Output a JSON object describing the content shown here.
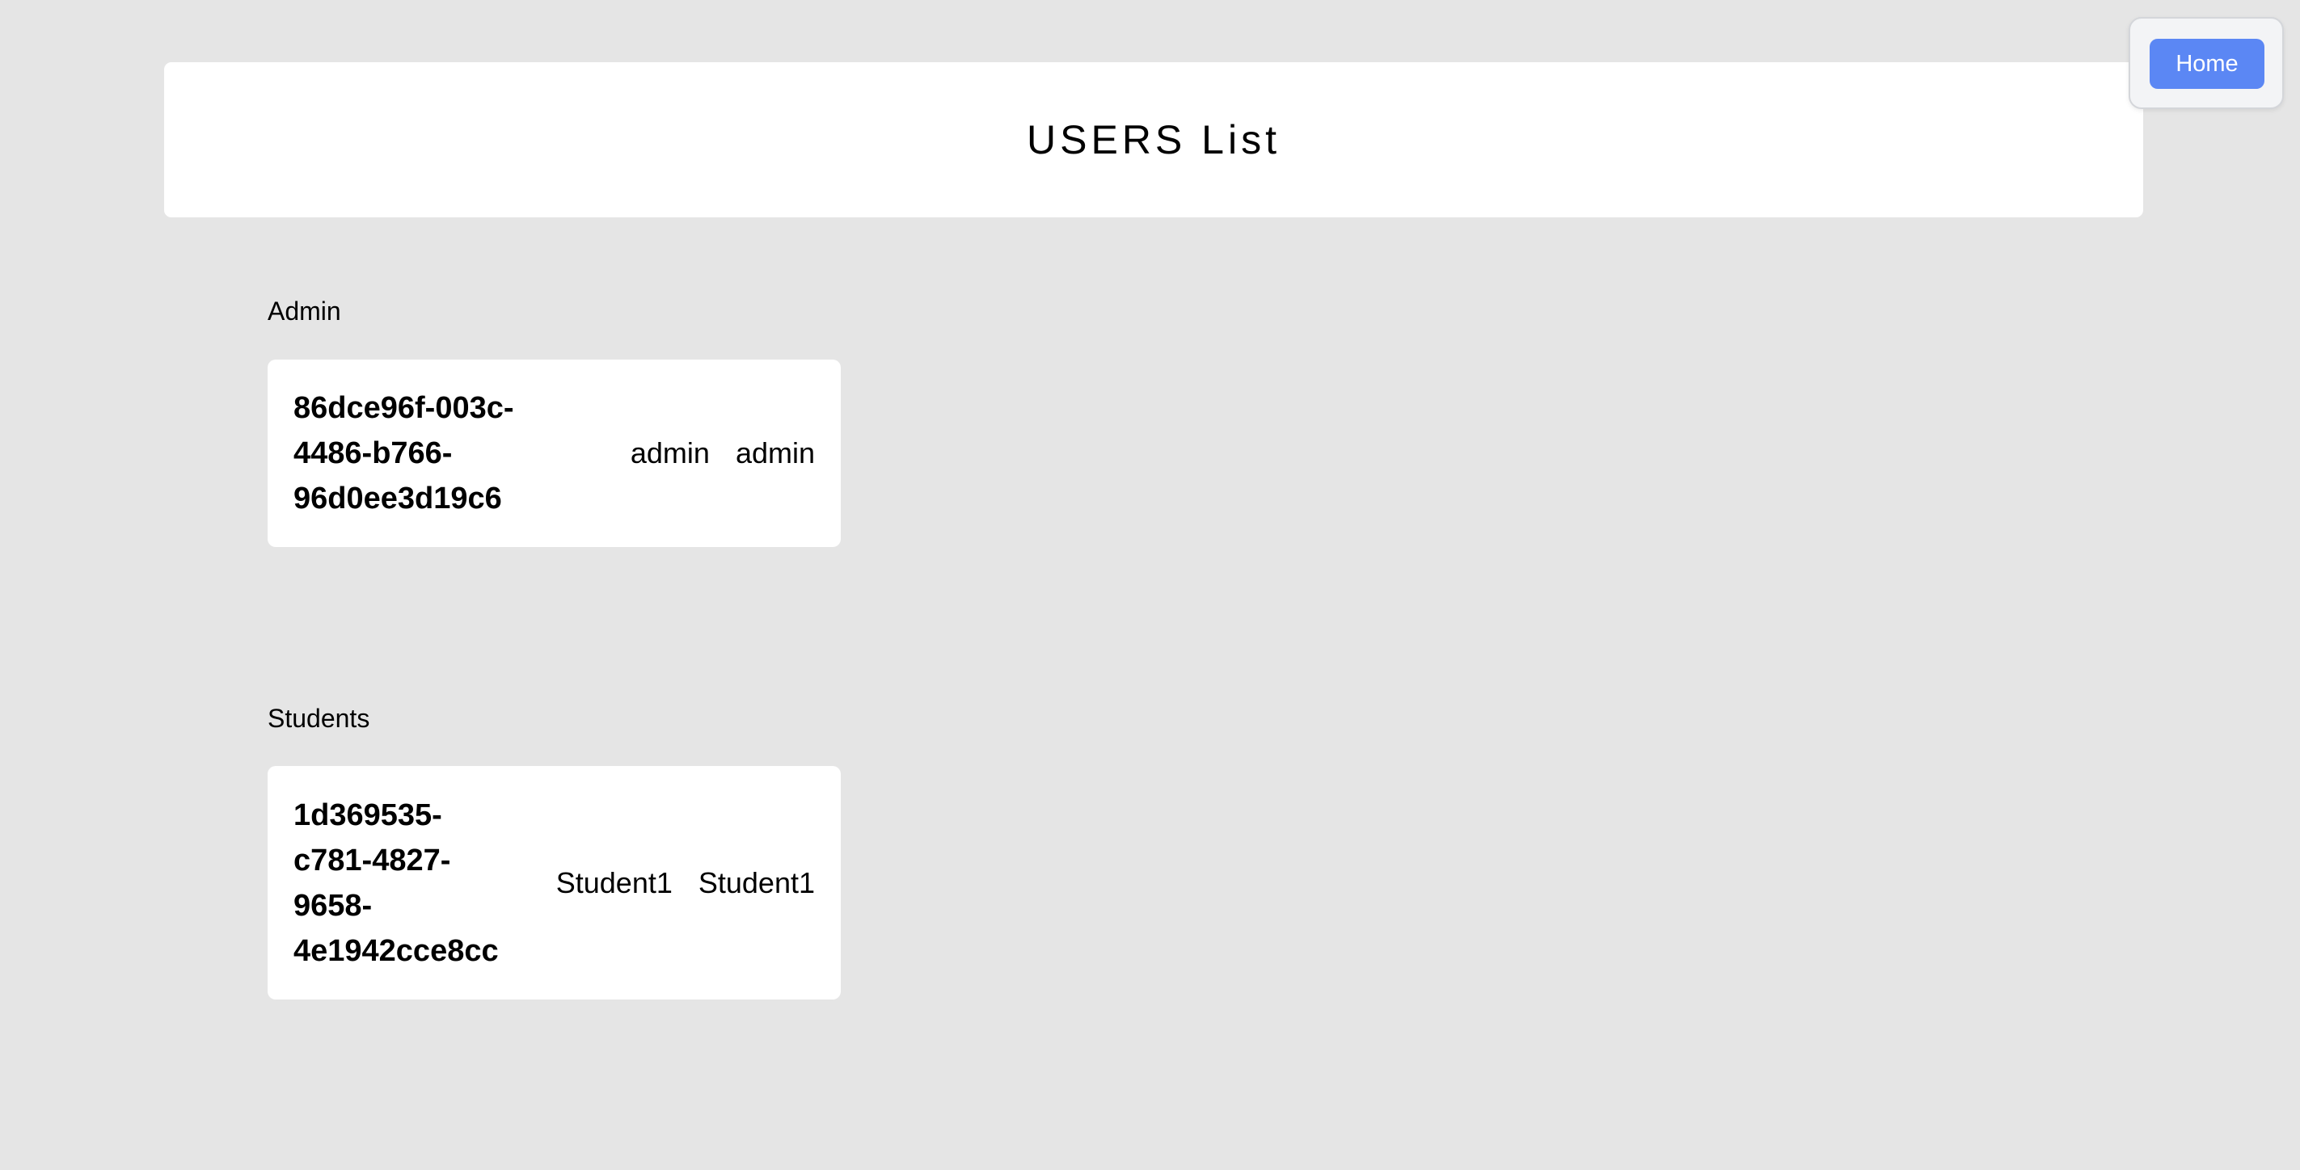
{
  "header": {
    "title": "USERS List"
  },
  "nav": {
    "home_label": "Home"
  },
  "sections": [
    {
      "label": "Admin",
      "users": [
        {
          "id_lines": [
            "86dce96f-003c-",
            "4486-b766-",
            "96d0ee3d19c6"
          ],
          "field1": "admin",
          "field2": "admin"
        }
      ]
    },
    {
      "label": "Students",
      "users": [
        {
          "id_lines": [
            "1d369535-",
            "c781-4827-",
            "9658-",
            "4e1942cce8cc"
          ],
          "field1": "Student1",
          "field2": "Student1"
        }
      ]
    }
  ],
  "colors": {
    "background": "#e5e5e5",
    "card": "#ffffff",
    "home_button": "#5b87f4"
  }
}
